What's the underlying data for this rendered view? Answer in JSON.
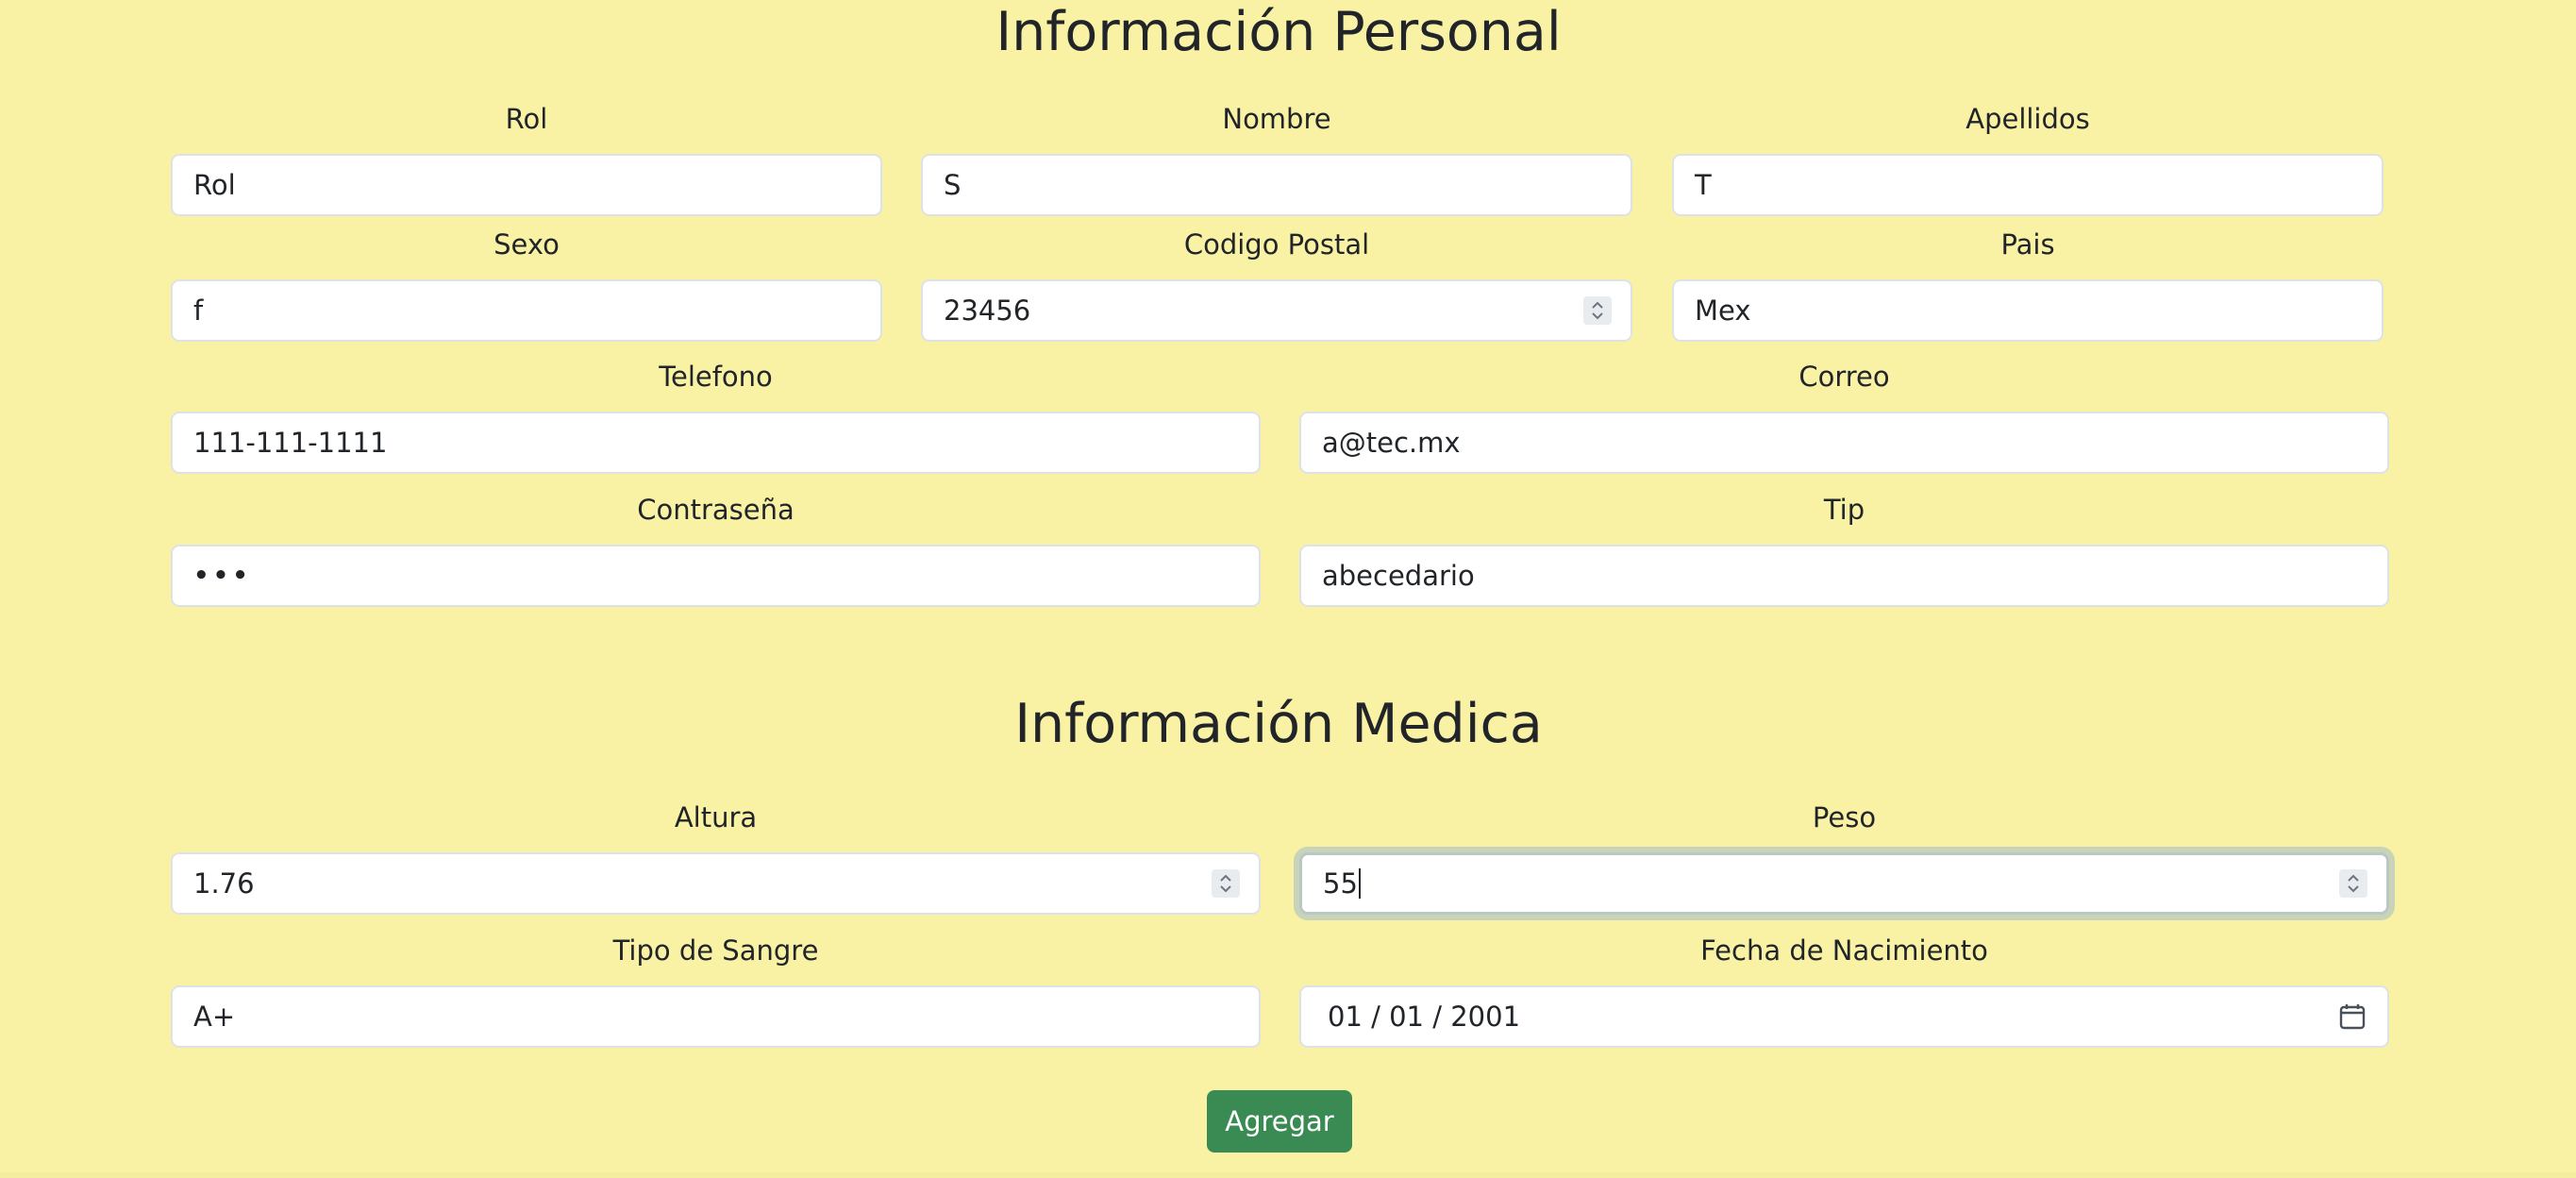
{
  "personal": {
    "title": "Información Personal",
    "rol": {
      "label": "Rol",
      "value": "Rol"
    },
    "nombre": {
      "label": "Nombre",
      "value": "S"
    },
    "apellidos": {
      "label": "Apellidos",
      "value": "T"
    },
    "sexo": {
      "label": "Sexo",
      "value": "f"
    },
    "codigo_postal": {
      "label": "Codigo Postal",
      "value": "23456"
    },
    "pais": {
      "label": "Pais",
      "value": "Mex"
    },
    "telefono": {
      "label": "Telefono",
      "value": "111-111-1111"
    },
    "correo": {
      "label": "Correo",
      "value": "a@tec.mx"
    },
    "contrasena": {
      "label": "Contraseña",
      "value": "•••"
    },
    "tip": {
      "label": "Tip",
      "value": "abecedario"
    }
  },
  "medica": {
    "title": "Información Medica",
    "altura": {
      "label": "Altura",
      "value": "1.76"
    },
    "peso": {
      "label": "Peso",
      "value": "55"
    },
    "tipo_sangre": {
      "label": "Tipo de Sangre",
      "value": "A+"
    },
    "fecha_nacimiento": {
      "label": "Fecha de Nacimiento",
      "value": "01 / 01 / 2001"
    }
  },
  "actions": {
    "submit_label": "Agregar"
  },
  "icons": {
    "number_spinner": "spinner-arrows-icon",
    "date_picker": "calendar-icon"
  },
  "colors": {
    "background": "#f9f2a4",
    "button": "#3a8a53"
  }
}
